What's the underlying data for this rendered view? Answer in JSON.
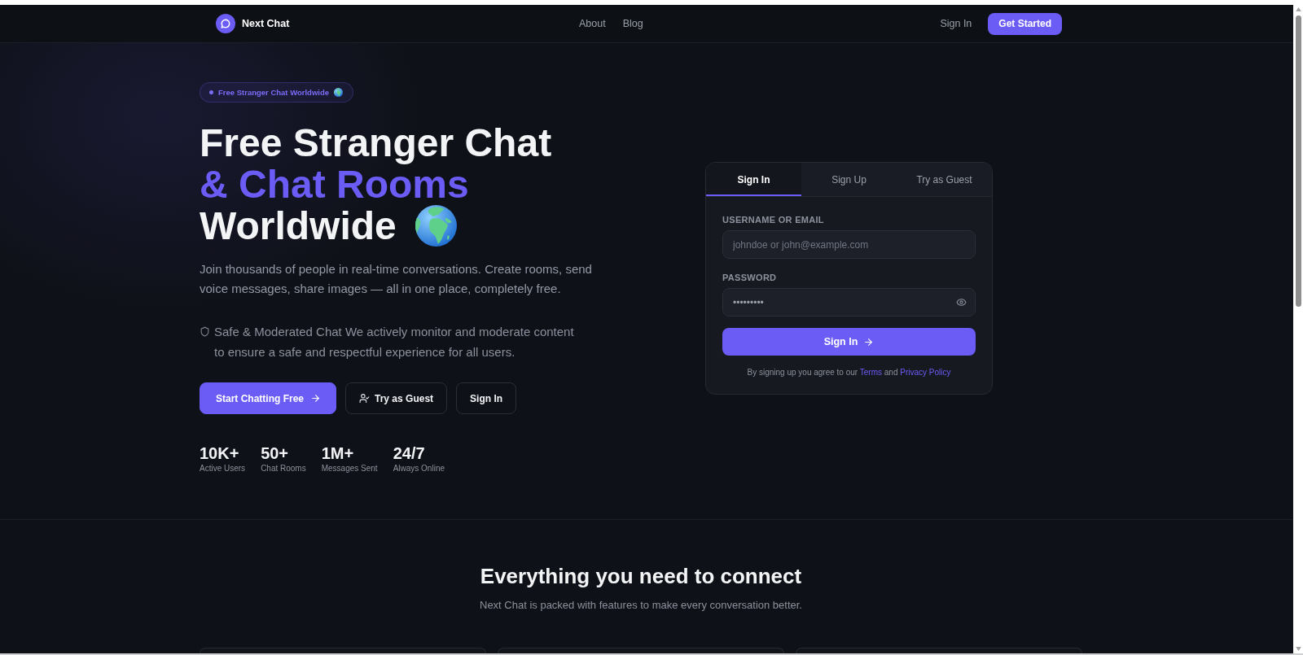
{
  "navbar": {
    "brand": "Next Chat",
    "links": [
      {
        "label": "About"
      },
      {
        "label": "Blog"
      }
    ],
    "sign_in": "Sign In",
    "cta": "Get Started"
  },
  "hero": {
    "badge": "Free Stranger Chat Worldwide",
    "title_lines": [
      {
        "text": "Free Stranger Chat",
        "highlighted": false
      },
      {
        "text": "& Chat Rooms",
        "highlighted": true
      },
      {
        "text": "Worldwide",
        "highlighted": false
      }
    ],
    "description": "Join thousands of people in real-time conversations. Create rooms, send voice messages, share images — all in one place, completely free.",
    "safety_note": "Safe & Moderated Chat We actively monitor and moderate content to ensure a safe and respectful experience for all users.",
    "buttons": [
      {
        "label": "Start Chatting Free",
        "kind": "primary"
      },
      {
        "label": "Try as Guest",
        "kind": "guest"
      },
      {
        "label": "Sign In",
        "kind": "outline"
      }
    ],
    "stats": [
      {
        "value": "10K+",
        "label": "Active Users"
      },
      {
        "value": "50+",
        "label": "Chat Rooms"
      },
      {
        "value": "1M+",
        "label": "Messages Sent"
      },
      {
        "value": "24/7",
        "label": "Always Online"
      }
    ]
  },
  "auth_card": {
    "tabs": [
      {
        "label": "Sign In",
        "selected": true
      },
      {
        "label": "Sign Up",
        "selected": false
      },
      {
        "label": "Try as Guest",
        "selected": false
      }
    ],
    "fields": [
      {
        "label": "USERNAME OR EMAIL",
        "placeholder": "johndoe or john@example.com",
        "kind": "text"
      },
      {
        "label": "PASSWORD",
        "value": "•••••••••",
        "kind": "password"
      }
    ],
    "submit": "Sign In",
    "agreement": [
      {
        "text": "By signing up you agree to our",
        "kind": "text"
      },
      {
        "text": "Terms",
        "kind": "link"
      },
      {
        "text": "and",
        "kind": "text"
      },
      {
        "text": "Privacy Policy",
        "kind": "link"
      }
    ]
  },
  "features": {
    "title": "Everything you need to connect",
    "subtitle": "Next Chat is packed with features to make every conversation better."
  }
}
